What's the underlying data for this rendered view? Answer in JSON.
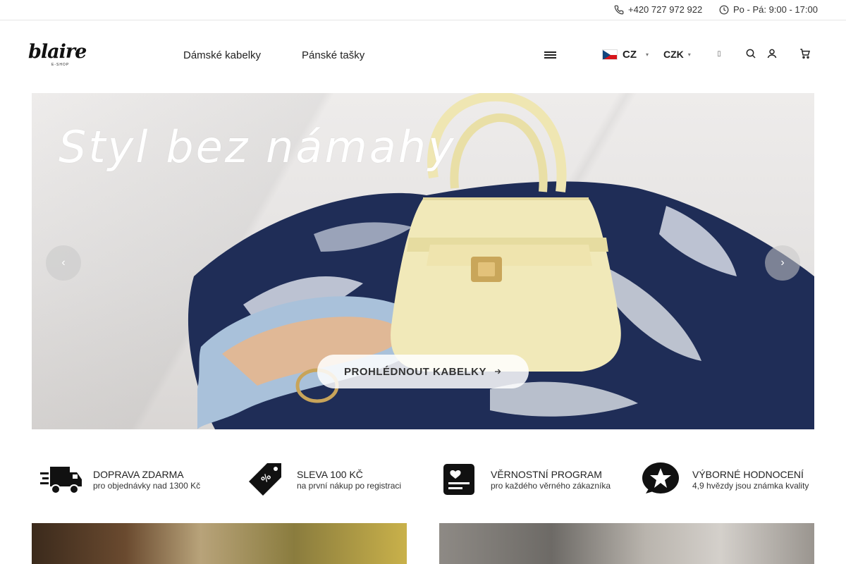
{
  "topbar": {
    "phone": "+420 727 972 922",
    "hours": "Po - Pá: 9:00 - 17:00"
  },
  "header": {
    "logo_text": "blaire",
    "logo_sub": "E-SHOP",
    "nav": [
      "Dámské kabelky",
      "Pánské tašky"
    ],
    "language": "CZ",
    "currency": "CZK",
    "icons": [
      "menu-icon",
      "search-icon",
      "user-icon",
      "cart-icon"
    ]
  },
  "hero": {
    "title": "Styl bez námahy",
    "cta": "PROHLÉDNOUT KABELKY",
    "colors": {
      "scarf_navy": "#1f2d57",
      "bag_cream": "#f1e9b9",
      "strap_blue": "#a9c1da"
    }
  },
  "benefits": [
    {
      "title": "DOPRAVA ZDARMA",
      "desc": "pro objednávky nad 1300 Kč",
      "icon": "truck-icon"
    },
    {
      "title": "SLEVA 100 KČ",
      "desc": "na první nákup po registraci",
      "icon": "discount-tag-icon"
    },
    {
      "title": "VĚRNOSTNÍ PROGRAM",
      "desc": "pro každého věrného zákazníka",
      "icon": "loyalty-card-icon"
    },
    {
      "title": "VÝBORNÉ HODNOCENÍ",
      "desc": "4,9 hvězdy jsou známka kvality",
      "icon": "star-bubble-icon"
    }
  ]
}
